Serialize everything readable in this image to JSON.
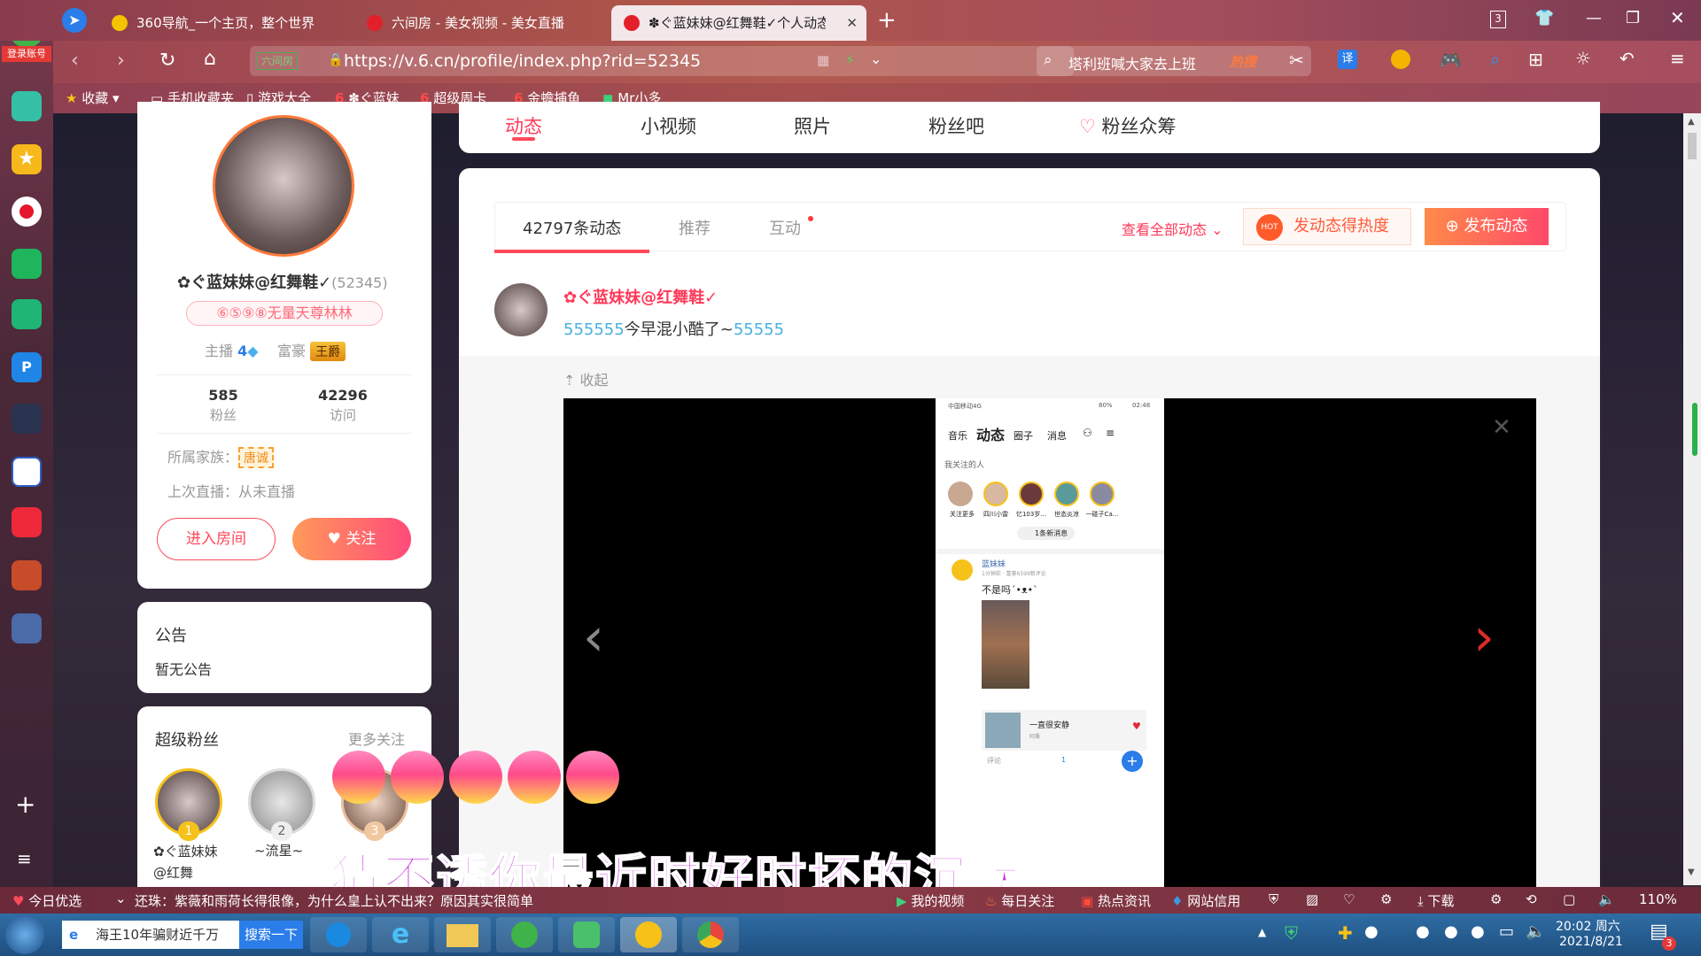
{
  "sidebar": {
    "login_label": "登录账号"
  },
  "tabs": [
    {
      "label": "360导航_一个主页，整个世界"
    },
    {
      "label": "六间房 - 美女视频 - 美女直播"
    },
    {
      "label": "✽ぐ蓝妹妹@红舞鞋✓个人动态"
    }
  ],
  "window": {
    "tab_count": "3"
  },
  "address": {
    "badge": "六间房",
    "url": "https://v.6.cn/profile/index.php?rid=52345"
  },
  "search": {
    "text": "塔利班喊大家去上班",
    "hot": "热搜"
  },
  "bookmarks": [
    {
      "label": "收藏"
    },
    {
      "label": "手机收藏夹"
    },
    {
      "label": "游戏大全"
    },
    {
      "label": "✽ぐ蓝妹"
    },
    {
      "label": "超级周卡"
    },
    {
      "label": "金蟾捕鱼"
    },
    {
      "label": "Mr小多"
    }
  ],
  "nav": {
    "items": [
      "动态",
      "小视频",
      "照片",
      "粉丝吧",
      "粉丝众筹"
    ]
  },
  "profile": {
    "name": "✿ぐ蓝妹妹@红舞鞋✓",
    "rid": "(52345)",
    "badge": "⑥⑤⑨⑧无量天尊林林",
    "anchor_label": "主播",
    "anchor_level": "4",
    "rich_label": "富豪",
    "rich_badge": "王爵",
    "fans_count": "585",
    "fans_label": "粉丝",
    "visits_count": "42296",
    "visits_label": "访问",
    "family_label": "所属家族：",
    "family_value": "唐诚",
    "last_live": "上次直播：从未直播",
    "enter_room": "进入房间",
    "follow": "关注"
  },
  "notice": {
    "title": "公告",
    "body": "暂无公告"
  },
  "superfans": {
    "title": "超级粉丝",
    "more": "更多关注",
    "fans": [
      {
        "rank": "1",
        "name": "✿ぐ蓝妹妹@红舞"
      },
      {
        "rank": "2",
        "name": "~流星~"
      },
      {
        "rank": "3",
        "name": ""
      }
    ]
  },
  "feed": {
    "tabs": [
      "42797条动态",
      "推荐",
      "互动"
    ],
    "view_all": "查看全部动态",
    "hot_btn": "发动态得热度",
    "post_btn": "发布动态",
    "post": {
      "author": "✿ぐ蓝妹妹@红舞鞋✓",
      "text": "今早混小酷了~",
      "collapse": "收起"
    }
  },
  "phone": {
    "status": "中国移动4G",
    "time": "02:48",
    "battery": "80%",
    "tabs": [
      "音乐",
      "动态",
      "圈子",
      "消息"
    ],
    "following_label": "我关注的人",
    "users": [
      "关注更多",
      "四川小雷",
      "忆103岁...",
      "世态炎凉",
      "一碰子Ca..."
    ],
    "new_msg": "1条新消息",
    "poster": "蓝妹妹",
    "post_meta": "1分钟前 · 富豪6599新评论",
    "post_text": "不是吗ˊ•ᴥ•ˋ",
    "song": "一直很安静",
    "singer": "阿桑",
    "comment": "评论",
    "like": "1"
  },
  "overlay": {
    "subtitle": "猜不透你最近时好时坏的沉默"
  },
  "bottom": {
    "left": "今日优选",
    "news": "还珠：紫薇和雨荷长得很像，为什么皇上认不出来？原因其实很简单",
    "items": [
      "我的视频",
      "每日关注",
      "热点资讯",
      "网站信用",
      "下载"
    ],
    "zoom": "110%"
  },
  "taskbar": {
    "search_text": "海王10年骗财近千万",
    "search_btn": "搜索一下",
    "time": "20:02 周六",
    "date": "2021/8/21",
    "badge": "3"
  }
}
